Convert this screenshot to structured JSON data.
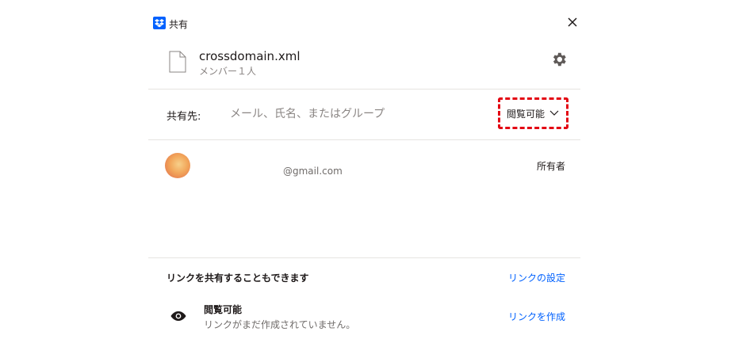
{
  "dialog": {
    "title": "共有",
    "accent_color": "#0061fe"
  },
  "file": {
    "name": "crossdomain.xml",
    "members": "メンバー１人"
  },
  "share": {
    "label": "共有先:",
    "placeholder": "メール、氏名、またはグループ",
    "permission": "閲覧可能",
    "highlight_color": "#e30613"
  },
  "members": [
    {
      "email": "@gmail.com",
      "role": "所有者"
    }
  ],
  "link": {
    "heading": "リンクを共有することもできます",
    "settings": "リンクの設定",
    "permission": "閲覧可能",
    "status": "リンクがまだ作成されていません。",
    "create": "リンクを作成"
  }
}
